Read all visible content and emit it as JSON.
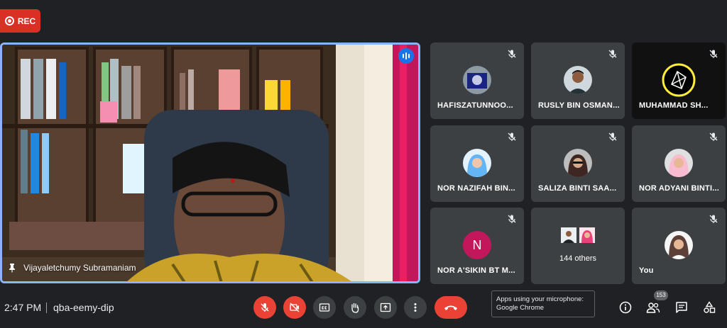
{
  "recording": {
    "label": "REC"
  },
  "main_speaker": {
    "name": "Vijayaletchumy Subramaniam"
  },
  "participants": [
    {
      "name": "HAFISZATUNNOO...",
      "avatar": "photo-icon",
      "muted": true
    },
    {
      "name": "RUSLY BIN OSMAN...",
      "avatar": "photo-icon",
      "muted": true
    },
    {
      "name": "MUHAMMAD SH...",
      "avatar": "logo-icon",
      "muted": true
    },
    {
      "name": "NOR NAZIFAH BIN...",
      "avatar": "photo-icon",
      "muted": true
    },
    {
      "name": "SALIZA BINTI SAA...",
      "avatar": "photo-icon",
      "muted": true
    },
    {
      "name": "NOR ADYANI BINTI...",
      "avatar": "photo-icon",
      "muted": true
    },
    {
      "name": "NOR A'SIKIN BT M...",
      "initial": "N",
      "muted": true
    },
    {
      "others_label": "144 others"
    },
    {
      "name": "You",
      "avatar": "photo-icon",
      "muted": true
    }
  ],
  "bottom_bar": {
    "time": "2:47 PM",
    "meeting_code": "qba-eemy-dip",
    "participant_count": "153"
  },
  "tooltip": {
    "line1": "Apps using your microphone:",
    "line2": "Google Chrome"
  },
  "colors": {
    "background": "#202124",
    "tile": "#3c4043",
    "danger": "#ea4335",
    "active_border": "#8ab4f8"
  }
}
